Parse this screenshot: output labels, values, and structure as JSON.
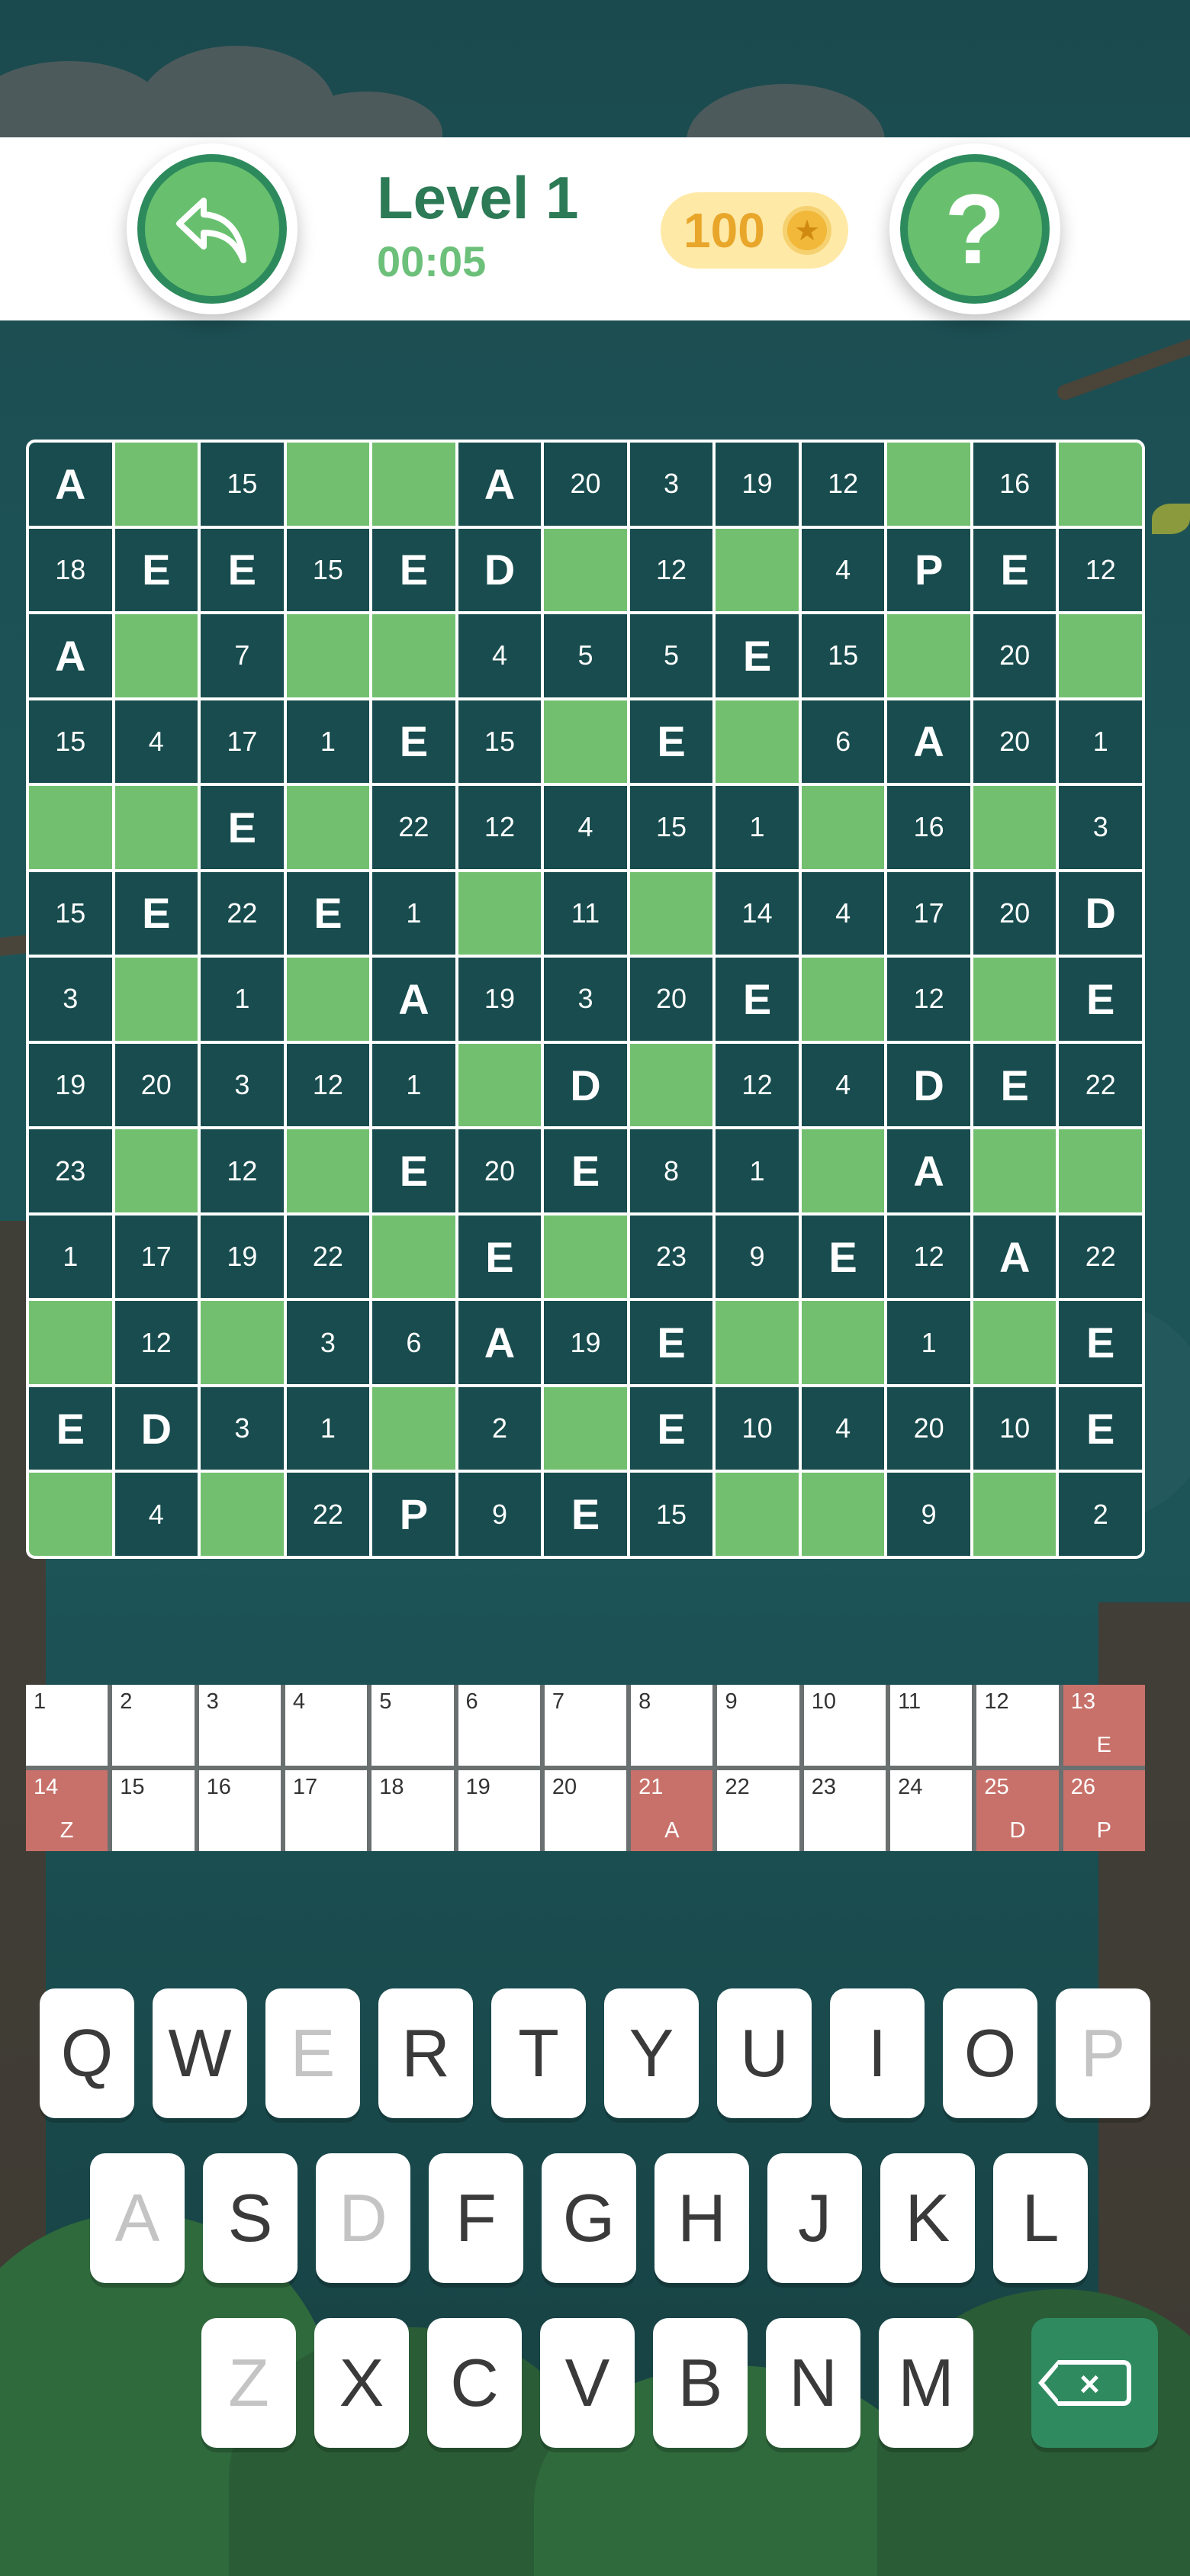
{
  "header": {
    "level_title": "Level 1",
    "timer": "00:05",
    "coins": "100",
    "help_label": "?"
  },
  "colors": {
    "cell_dark": "#184c4e",
    "cell_block": "#72c06f",
    "accent_green": "#2d7a56",
    "solved_key": "#c8716a",
    "coin_bg": "#ffe9a6"
  },
  "board": {
    "rows": [
      [
        "A",
        "#",
        "15",
        "#",
        "#",
        "A",
        "20",
        "3",
        "19",
        "12",
        "#",
        "16",
        "#"
      ],
      [
        "18",
        "E",
        "E",
        "15",
        "E",
        "D",
        "#",
        "12",
        "#",
        "4",
        "P",
        "E",
        "12"
      ],
      [
        "A",
        "#",
        "7",
        "#",
        "#",
        "4",
        "5",
        "5",
        "E",
        "15",
        "#",
        "20",
        "#"
      ],
      [
        "15",
        "4",
        "17",
        "1",
        "E",
        "15",
        "#",
        "E",
        "#",
        "6",
        "A",
        "20",
        "1"
      ],
      [
        "#",
        "#",
        "E",
        "#",
        "22",
        "12",
        "4",
        "15",
        "1",
        "#",
        "16",
        "#",
        "3"
      ],
      [
        "15",
        "E",
        "22",
        "E",
        "1",
        "#",
        "11",
        "#",
        "14",
        "4",
        "17",
        "20",
        "D"
      ],
      [
        "3",
        "#",
        "1",
        "#",
        "A",
        "19",
        "3",
        "20",
        "E",
        "#",
        "12",
        "#",
        "E"
      ],
      [
        "19",
        "20",
        "3",
        "12",
        "1",
        "#",
        "D",
        "#",
        "12",
        "4",
        "D",
        "E",
        "22"
      ],
      [
        "23",
        "#",
        "12",
        "#",
        "E",
        "20",
        "E",
        "8",
        "1",
        "#",
        "A",
        "#",
        "#"
      ],
      [
        "1",
        "17",
        "19",
        "22",
        "#",
        "E",
        "#",
        "23",
        "9",
        "E",
        "12",
        "A",
        "22"
      ],
      [
        "#",
        "12",
        "#",
        "3",
        "6",
        "A",
        "19",
        "E",
        "#",
        "#",
        "1",
        "#",
        "E"
      ],
      [
        "E",
        "D",
        "3",
        "1",
        "#",
        "2",
        "#",
        "E",
        "10",
        "4",
        "20",
        "10",
        "E"
      ],
      [
        "#",
        "4",
        "#",
        "22",
        "P",
        "9",
        "E",
        "15",
        "#",
        "#",
        "9",
        "#",
        "2"
      ]
    ]
  },
  "legend": {
    "cells": [
      {
        "num": "1",
        "letter": ""
      },
      {
        "num": "2",
        "letter": ""
      },
      {
        "num": "3",
        "letter": ""
      },
      {
        "num": "4",
        "letter": ""
      },
      {
        "num": "5",
        "letter": ""
      },
      {
        "num": "6",
        "letter": ""
      },
      {
        "num": "7",
        "letter": ""
      },
      {
        "num": "8",
        "letter": ""
      },
      {
        "num": "9",
        "letter": ""
      },
      {
        "num": "10",
        "letter": ""
      },
      {
        "num": "11",
        "letter": ""
      },
      {
        "num": "12",
        "letter": ""
      },
      {
        "num": "13",
        "letter": "E"
      },
      {
        "num": "14",
        "letter": "Z"
      },
      {
        "num": "15",
        "letter": ""
      },
      {
        "num": "16",
        "letter": ""
      },
      {
        "num": "17",
        "letter": ""
      },
      {
        "num": "18",
        "letter": ""
      },
      {
        "num": "19",
        "letter": ""
      },
      {
        "num": "20",
        "letter": ""
      },
      {
        "num": "21",
        "letter": "A"
      },
      {
        "num": "22",
        "letter": ""
      },
      {
        "num": "23",
        "letter": ""
      },
      {
        "num": "24",
        "letter": ""
      },
      {
        "num": "25",
        "letter": "D"
      },
      {
        "num": "26",
        "letter": "P"
      }
    ]
  },
  "keyboard": {
    "rows": [
      [
        {
          "k": "Q",
          "used": false
        },
        {
          "k": "W",
          "used": false
        },
        {
          "k": "E",
          "used": true
        },
        {
          "k": "R",
          "used": false
        },
        {
          "k": "T",
          "used": false
        },
        {
          "k": "Y",
          "used": false
        },
        {
          "k": "U",
          "used": false
        },
        {
          "k": "I",
          "used": false
        },
        {
          "k": "O",
          "used": false
        },
        {
          "k": "P",
          "used": true
        }
      ],
      [
        {
          "k": "A",
          "used": true
        },
        {
          "k": "S",
          "used": false
        },
        {
          "k": "D",
          "used": true
        },
        {
          "k": "F",
          "used": false
        },
        {
          "k": "G",
          "used": false
        },
        {
          "k": "H",
          "used": false
        },
        {
          "k": "J",
          "used": false
        },
        {
          "k": "K",
          "used": false
        },
        {
          "k": "L",
          "used": false
        }
      ],
      [
        {
          "k": "Z",
          "used": true
        },
        {
          "k": "X",
          "used": false
        },
        {
          "k": "C",
          "used": false
        },
        {
          "k": "V",
          "used": false
        },
        {
          "k": "B",
          "used": false
        },
        {
          "k": "N",
          "used": false
        },
        {
          "k": "M",
          "used": false
        }
      ]
    ]
  }
}
